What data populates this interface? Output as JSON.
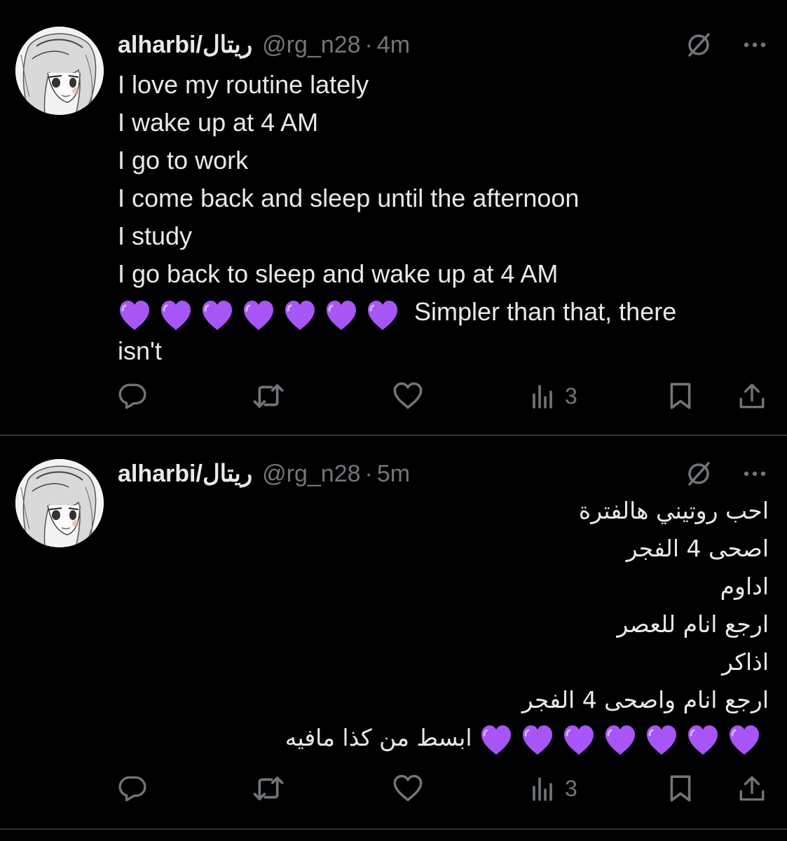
{
  "colors": {
    "background": "#000000",
    "primary_text": "#e7e9ea",
    "secondary_text": "#71767b",
    "divider": "#2f3336",
    "heart": "#a855f7"
  },
  "tweets": [
    {
      "author": {
        "display_name": "alharbi/ريتال",
        "handle": "@rg_n28"
      },
      "separator": "·",
      "time": "4m",
      "language": "en",
      "lines": [
        "I love my routine lately",
        "I wake up at 4 AM",
        "I go to work",
        "I come back and sleep until the afternoon",
        "I study",
        "I go back to sleep and wake up at 4 AM"
      ],
      "emoji_line": {
        "heart_count": 7,
        "heart_icon": "purple-heart-icon",
        "text": "Simpler than that, there"
      },
      "trailing_line": "isn't",
      "actions": {
        "views_count": "3"
      }
    },
    {
      "author": {
        "display_name": "alharbi/ريتال",
        "handle": "@rg_n28"
      },
      "separator": "·",
      "time": "5m",
      "language": "ar",
      "lines": [
        "احب روتيني هالفترة",
        "اصحى 4 الفجر",
        "اداوم",
        "ارجع انام للعصر",
        "اذاكر",
        "ارجع انام واصحى 4 الفجر"
      ],
      "emoji_line": {
        "heart_count": 7,
        "heart_icon": "purple-heart-icon",
        "text": "ابسط من كذا مافيه"
      },
      "actions": {
        "views_count": "3"
      }
    }
  ]
}
